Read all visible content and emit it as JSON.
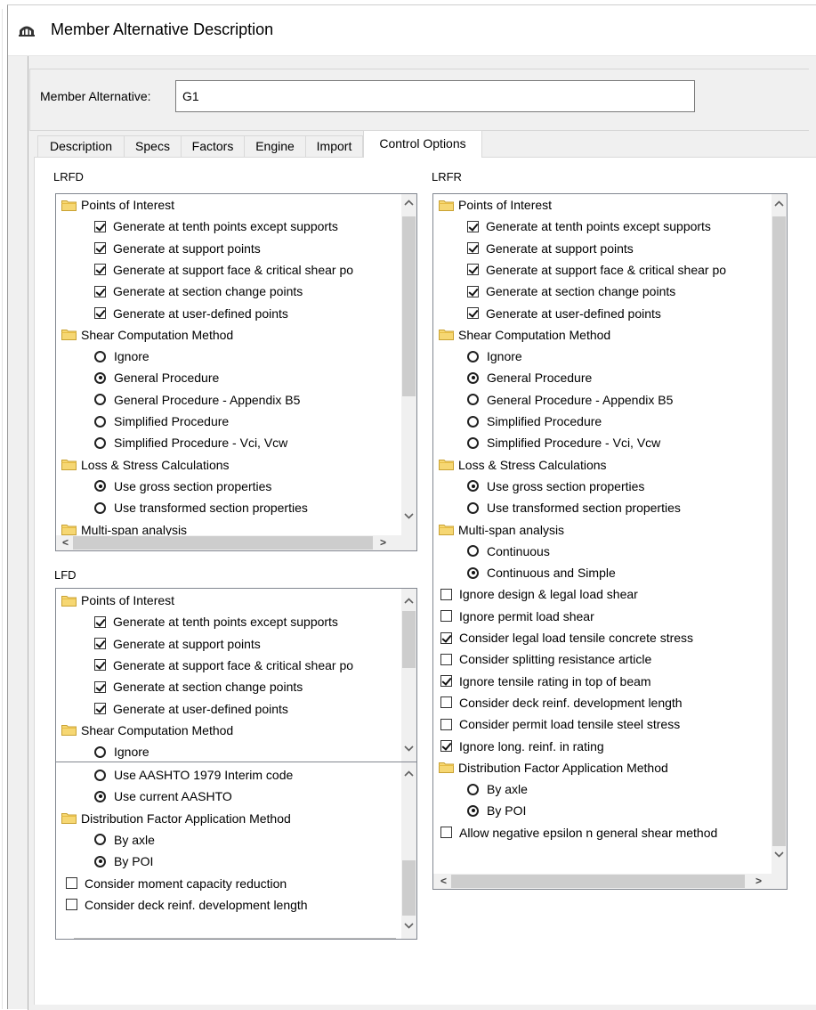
{
  "window": {
    "title": "Member Alternative Description"
  },
  "alternative": {
    "label": "Member Alternative:",
    "value": "G1"
  },
  "tabs": [
    "Description",
    "Specs",
    "Factors",
    "Engine",
    "Import",
    "Control Options"
  ],
  "active_tab": "Control Options",
  "lrfd": {
    "label": "LRFD",
    "items": [
      {
        "kind": "folder",
        "text": "Points of Interest"
      },
      {
        "kind": "check",
        "checked": true,
        "text": "Generate at tenth points except supports"
      },
      {
        "kind": "check",
        "checked": true,
        "text": "Generate at support points"
      },
      {
        "kind": "check",
        "checked": true,
        "text": "Generate at support face & critical shear po"
      },
      {
        "kind": "check",
        "checked": true,
        "text": "Generate at section change points"
      },
      {
        "kind": "check",
        "checked": true,
        "text": "Generate at user-defined points"
      },
      {
        "kind": "folder",
        "text": "Shear Computation Method"
      },
      {
        "kind": "radio",
        "checked": false,
        "text": "Ignore"
      },
      {
        "kind": "radio",
        "checked": true,
        "text": "General Procedure"
      },
      {
        "kind": "radio",
        "checked": false,
        "text": "General Procedure - Appendix B5"
      },
      {
        "kind": "radio",
        "checked": false,
        "text": "Simplified Procedure"
      },
      {
        "kind": "radio",
        "checked": false,
        "text": "Simplified Procedure - Vci, Vcw"
      },
      {
        "kind": "folder",
        "text": "Loss & Stress Calculations"
      },
      {
        "kind": "radio",
        "checked": true,
        "text": "Use gross section properties"
      },
      {
        "kind": "radio",
        "checked": false,
        "text": "Use transformed section properties"
      },
      {
        "kind": "folder",
        "text": "Multi-span analysis"
      }
    ]
  },
  "lfd": {
    "label": "LFD",
    "items": [
      {
        "kind": "folder",
        "text": "Points of Interest"
      },
      {
        "kind": "check",
        "checked": true,
        "text": "Generate at tenth points except supports"
      },
      {
        "kind": "check",
        "checked": true,
        "text": "Generate at support points"
      },
      {
        "kind": "check",
        "checked": true,
        "text": "Generate at support face & critical shear po"
      },
      {
        "kind": "check",
        "checked": true,
        "text": "Generate at section change points"
      },
      {
        "kind": "check",
        "checked": true,
        "text": "Generate at user-defined points"
      },
      {
        "kind": "folder",
        "text": "Shear Computation Method"
      },
      {
        "kind": "radio",
        "checked": false,
        "text": "Ignore"
      }
    ],
    "lower_items": [
      {
        "kind": "radio",
        "checked": false,
        "text": "Use AASHTO 1979 Interim code"
      },
      {
        "kind": "radio",
        "checked": true,
        "text": "Use current AASHTO"
      },
      {
        "kind": "folder",
        "text": "Distribution Factor Application Method"
      },
      {
        "kind": "radio",
        "checked": false,
        "text": "By axle"
      },
      {
        "kind": "radio",
        "checked": true,
        "text": "By POI"
      },
      {
        "kind": "check0",
        "checked": false,
        "text": "Consider moment capacity reduction"
      },
      {
        "kind": "check0",
        "checked": false,
        "text": "Consider deck reinf. development length"
      }
    ]
  },
  "lrfr": {
    "label": "LRFR",
    "items": [
      {
        "kind": "folder",
        "text": "Points of Interest"
      },
      {
        "kind": "check",
        "checked": true,
        "text": "Generate at tenth points except supports"
      },
      {
        "kind": "check",
        "checked": true,
        "text": "Generate at support points"
      },
      {
        "kind": "check",
        "checked": true,
        "text": "Generate at support face & critical shear po"
      },
      {
        "kind": "check",
        "checked": true,
        "text": "Generate at section change points"
      },
      {
        "kind": "check",
        "checked": true,
        "text": "Generate at user-defined points"
      },
      {
        "kind": "folder",
        "text": "Shear Computation Method"
      },
      {
        "kind": "radio",
        "checked": false,
        "text": "Ignore"
      },
      {
        "kind": "radio",
        "checked": true,
        "text": "General Procedure"
      },
      {
        "kind": "radio",
        "checked": false,
        "text": "General Procedure - Appendix B5"
      },
      {
        "kind": "radio",
        "checked": false,
        "text": "Simplified Procedure"
      },
      {
        "kind": "radio",
        "checked": false,
        "text": "Simplified Procedure - Vci, Vcw"
      },
      {
        "kind": "folder",
        "text": "Loss & Stress Calculations"
      },
      {
        "kind": "radio",
        "checked": true,
        "text": "Use gross section properties"
      },
      {
        "kind": "radio",
        "checked": false,
        "text": "Use transformed section properties"
      },
      {
        "kind": "folder",
        "text": "Multi-span analysis"
      },
      {
        "kind": "radio",
        "checked": false,
        "text": "Continuous"
      },
      {
        "kind": "radio",
        "checked": true,
        "text": "Continuous and Simple"
      },
      {
        "kind": "check0",
        "checked": false,
        "text": "Ignore design & legal load shear"
      },
      {
        "kind": "check0",
        "checked": false,
        "text": "Ignore permit load shear"
      },
      {
        "kind": "check0",
        "checked": true,
        "text": "Consider legal load tensile concrete stress"
      },
      {
        "kind": "check0",
        "checked": false,
        "text": "Consider splitting resistance article"
      },
      {
        "kind": "check0",
        "checked": true,
        "text": "Ignore tensile rating in top of beam"
      },
      {
        "kind": "check0",
        "checked": false,
        "text": "Consider deck reinf. development length"
      },
      {
        "kind": "check0",
        "checked": false,
        "text": "Consider permit load tensile steel stress"
      },
      {
        "kind": "check0",
        "checked": true,
        "text": "Ignore long. reinf. in rating"
      },
      {
        "kind": "folder",
        "text": "Distribution Factor Application Method"
      },
      {
        "kind": "radio",
        "checked": false,
        "text": "By axle"
      },
      {
        "kind": "radio",
        "checked": true,
        "text": "By POI"
      },
      {
        "kind": "check0",
        "checked": false,
        "text": "Allow negative epsilon n general shear method"
      }
    ]
  },
  "icons": {
    "title": "bridge-icon",
    "folder": "folder-icon",
    "scroll_up": "▲",
    "scroll_down": "▼",
    "scroll_left": "<",
    "scroll_right": ">"
  }
}
